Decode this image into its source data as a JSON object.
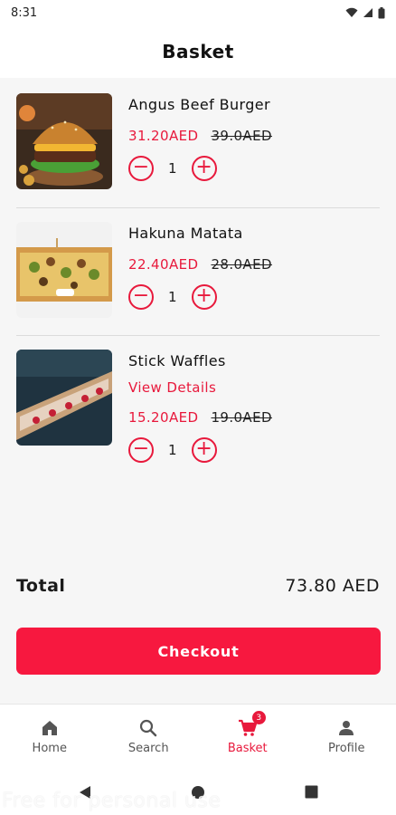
{
  "status_bar": {
    "time": "8:31"
  },
  "header": {
    "title": "Basket"
  },
  "items": [
    {
      "name": "Angus Beef Burger",
      "price": "31.20AED",
      "old_price": "39.0AED",
      "qty": "1"
    },
    {
      "name": "Hakuna Matata",
      "price": "22.40AED",
      "old_price": "28.0AED",
      "qty": "1"
    },
    {
      "name": "Stick Waffles",
      "details_link": "View Details",
      "price": "15.20AED",
      "old_price": "19.0AED",
      "qty": "1"
    }
  ],
  "total": {
    "label": "Total",
    "value": "73.80 AED"
  },
  "checkout_label": "Checkout",
  "bottom_nav": [
    {
      "label": "Home",
      "icon": "home-icon"
    },
    {
      "label": "Search",
      "icon": "search-icon"
    },
    {
      "label": "Basket",
      "icon": "cart-icon",
      "badge": "3",
      "active": true
    },
    {
      "label": "Profile",
      "icon": "profile-icon"
    }
  ],
  "watermark": "Free for personal use",
  "colors": {
    "accent": "#e8193c",
    "button": "#f7183f"
  }
}
